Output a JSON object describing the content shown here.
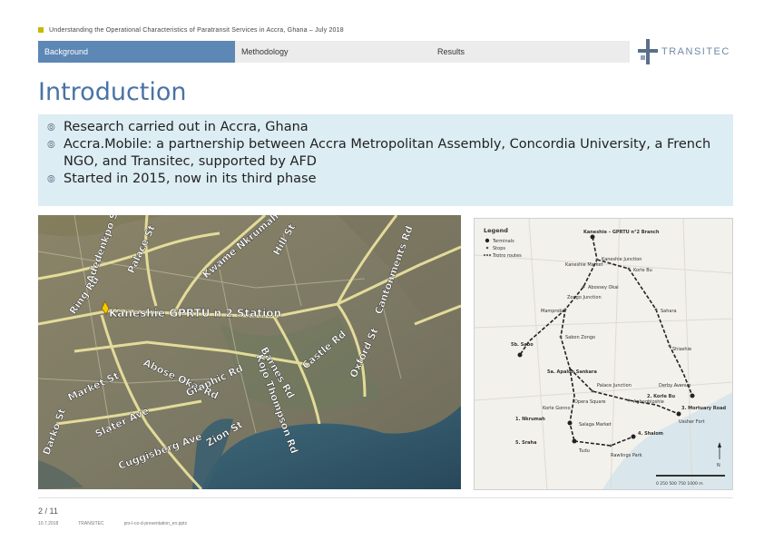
{
  "header": {
    "doc_title": "Understanding the Operational Characteristics of Paratransit Services in Accra, Ghana – July 2018"
  },
  "nav": {
    "tabs": [
      {
        "label": "Background",
        "active": true
      },
      {
        "label": "Methodology",
        "active": false
      },
      {
        "label": "Results",
        "active": false
      }
    ],
    "active_color": "#5d87b5"
  },
  "logo": {
    "text": "TRANSITEC"
  },
  "slide": {
    "title": "Introduction",
    "bullets": [
      "Research carried out in Accra, Ghana",
      "Accra.Mobile: a partnership between Accra Metropolitan Assembly, Concordia University, a French NGO, and Transitec, supported by AFD",
      "Started in 2015, now in its third phase"
    ]
  },
  "satellite_map": {
    "marker_label": "Kaneshie GPRTU n 2 Station",
    "road_labels": [
      "Ring Rd",
      "Abose Okai Rd",
      "Graphic Rd",
      "Kojo Thompson Rd",
      "Barnes Rd",
      "Castle Rd",
      "Oxford St",
      "Cantonments Rd",
      "Farrar Ave",
      "Zion St",
      "Cuggisberg Ave",
      "Slater Ave",
      "Market St",
      "Darko St",
      "Kwame Nkrumah Ave",
      "Hill St",
      "Palace St",
      "Adedenkpo St",
      "Kaneshie"
    ]
  },
  "route_map": {
    "legend_title": "Legend",
    "legend_items": [
      "Terminals",
      "Stops",
      "Trotro routes"
    ],
    "stops": [
      "Kaneshie – GPRTU n°2 Branch",
      "Kaneshie Junction",
      "Kaneshie Market",
      "Abossey Okai",
      "Korle Bu",
      "Zongo Junction",
      "Mamprobi",
      "Sabon Zongo",
      "5b. Sabo",
      "5a. Apaloh Sankara",
      "Palace Junction",
      "Sahara",
      "Shiashie",
      "Agbogbloshie",
      "Opera Square",
      "Korle Gonno",
      "1. Nkrumah",
      "2. Korle Bu",
      "3. Mortuary Road",
      "4. Shalom",
      "5. Sraha",
      "Salaga Market",
      "Tudu",
      "Rawlings Park",
      "Derby Avenue",
      "Ussher Fort"
    ],
    "scale_label": "0 250 500 750 1000 m",
    "north_label": "N"
  },
  "footer": {
    "page": "2 / 11",
    "date": "10.7.2018",
    "company": "TRANSITEC",
    "file": "prs-l-co-d-presentation_en.pptx"
  }
}
